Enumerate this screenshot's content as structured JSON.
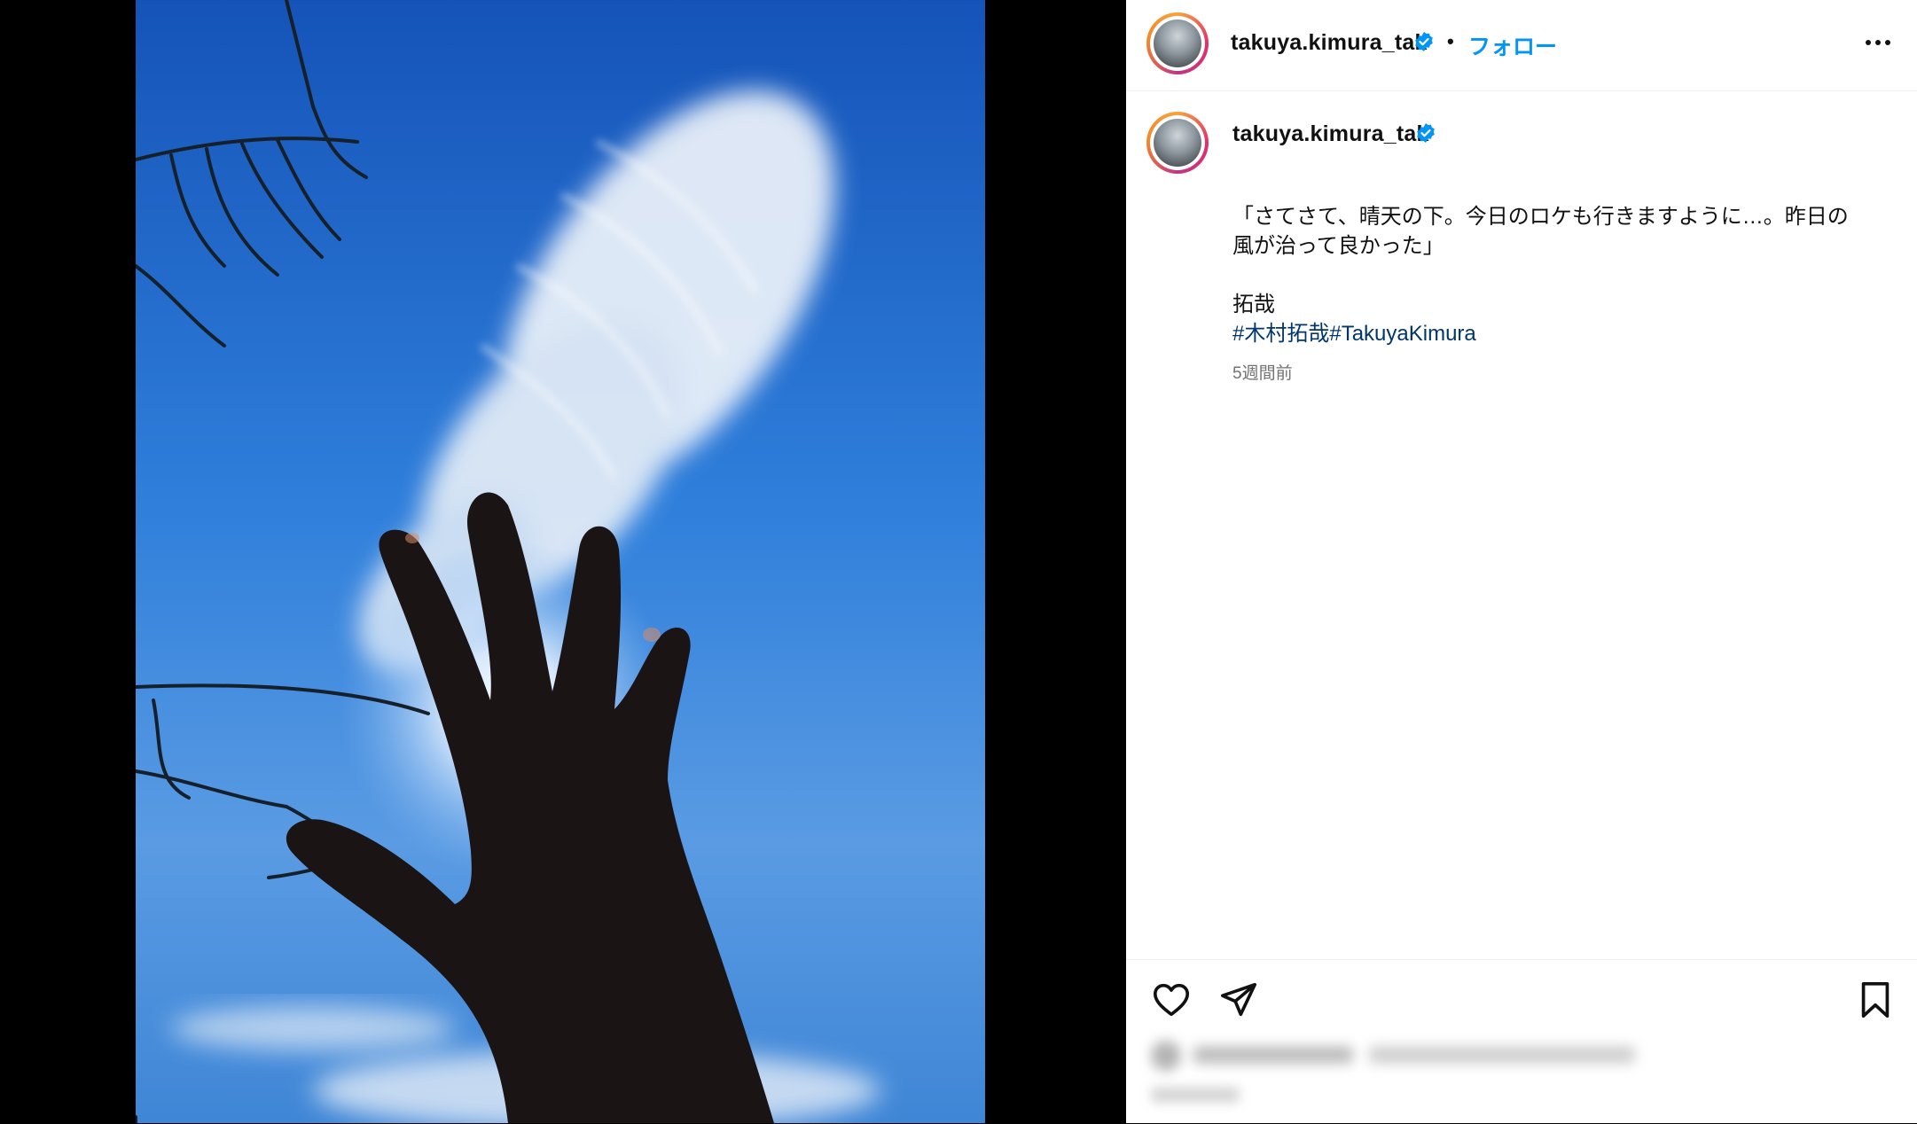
{
  "post": {
    "username": "takuya.kimura_tak",
    "follow_label": "フォロー",
    "dot": "•",
    "caption_line1": "「さてさて、晴天の下。今日のロケも行きますように…。昨日の",
    "caption_line2": "風が治って良かった」",
    "signature": "拓哉",
    "hashtag1": "#木村拓哉",
    "hashtag2": "#TakuyaKimura",
    "timestamp": "5週間前"
  },
  "colors": {
    "accent": "#0095f6",
    "hashtag": "#00376b",
    "sky": "#1f6fd1"
  },
  "icons": {
    "verified": "verified-badge-icon",
    "more": "more-options-icon",
    "like": "heart-icon",
    "share": "paper-plane-icon",
    "save": "bookmark-icon"
  }
}
